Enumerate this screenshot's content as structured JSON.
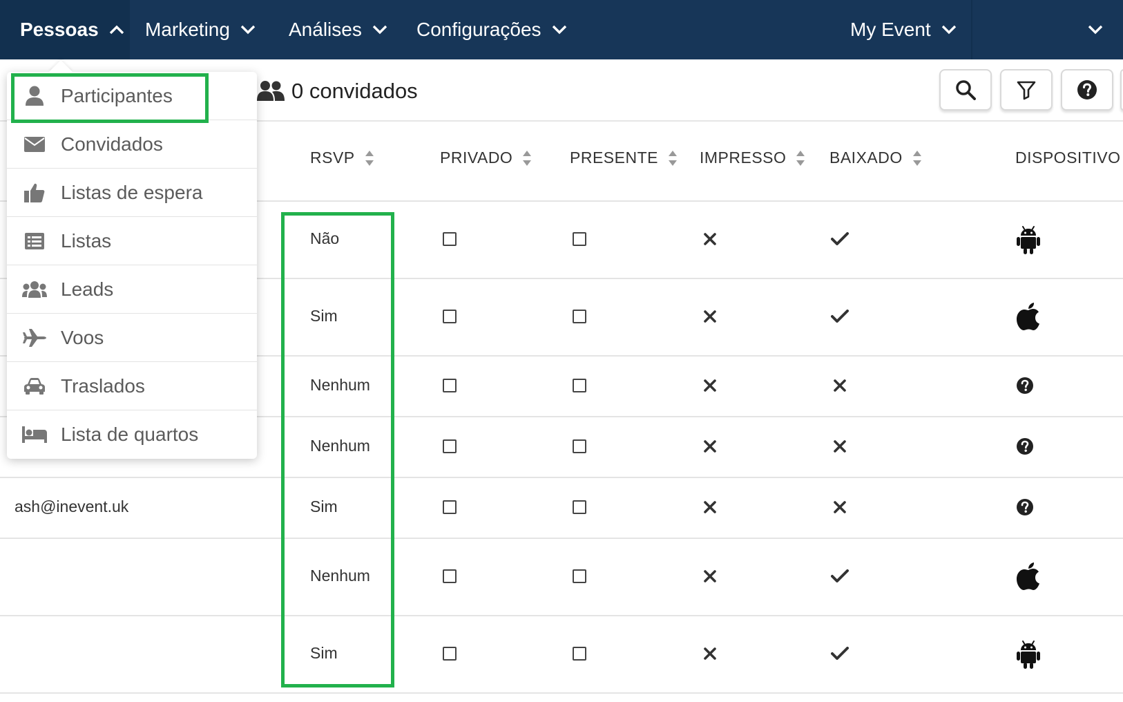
{
  "nav": {
    "items": [
      {
        "label": "Pessoas",
        "active": true,
        "chevron": "chevron-up-icon"
      },
      {
        "label": "Marketing",
        "chevron": "chevron-down-icon"
      },
      {
        "label": "Análises",
        "chevron": "chevron-down-icon"
      },
      {
        "label": "Configurações",
        "chevron": "chevron-down-icon"
      },
      {
        "label": "My Event",
        "chevron": "chevron-down-icon"
      }
    ],
    "colors": {
      "background": "#173658",
      "active": "#12304f"
    }
  },
  "dropdown": {
    "items": [
      {
        "label": "Participantes",
        "icon": "user-icon",
        "highlighted": true
      },
      {
        "label": "Convidados",
        "icon": "envelope-icon"
      },
      {
        "label": "Listas de espera",
        "icon": "thumbs-up-icon"
      },
      {
        "label": "Listas",
        "icon": "list-icon"
      },
      {
        "label": "Leads",
        "icon": "users-icon"
      },
      {
        "label": "Voos",
        "icon": "plane-icon"
      },
      {
        "label": "Traslados",
        "icon": "car-icon"
      },
      {
        "label": "Lista de quartos",
        "icon": "bed-icon"
      }
    ]
  },
  "toolbar": {
    "count_label": "0 convidados",
    "buttons": [
      "search-icon",
      "filter-icon",
      "help-icon"
    ]
  },
  "table": {
    "columns": [
      "RSVP",
      "PRIVADO",
      "PRESENTE",
      "IMPRESSO",
      "BAIXADO",
      "DISPOSITIVO"
    ],
    "rows": [
      {
        "email": "",
        "rsvp": "Não",
        "privado": false,
        "presente": false,
        "impresso": "x",
        "baixado": "check",
        "dispositivo": "android-icon"
      },
      {
        "email": "",
        "rsvp": "Sim",
        "privado": false,
        "presente": false,
        "impresso": "x",
        "baixado": "check",
        "dispositivo": "apple-icon"
      },
      {
        "email": "",
        "rsvp": "Nenhum",
        "privado": false,
        "presente": false,
        "impresso": "x",
        "baixado": "x",
        "dispositivo": "question-icon"
      },
      {
        "email": "",
        "rsvp": "Nenhum",
        "privado": false,
        "presente": false,
        "impresso": "x",
        "baixado": "x",
        "dispositivo": "question-icon"
      },
      {
        "email": "ash@inevent.uk",
        "rsvp": "Sim",
        "privado": false,
        "presente": false,
        "impresso": "x",
        "baixado": "x",
        "dispositivo": "question-icon"
      },
      {
        "email": "",
        "rsvp": "Nenhum",
        "privado": false,
        "presente": false,
        "impresso": "x",
        "baixado": "check",
        "dispositivo": "apple-icon"
      },
      {
        "email": "",
        "rsvp": "Sim",
        "privado": false,
        "presente": false,
        "impresso": "x",
        "baixado": "check",
        "dispositivo": "android-icon"
      }
    ]
  },
  "highlight_color": "#22b14c"
}
